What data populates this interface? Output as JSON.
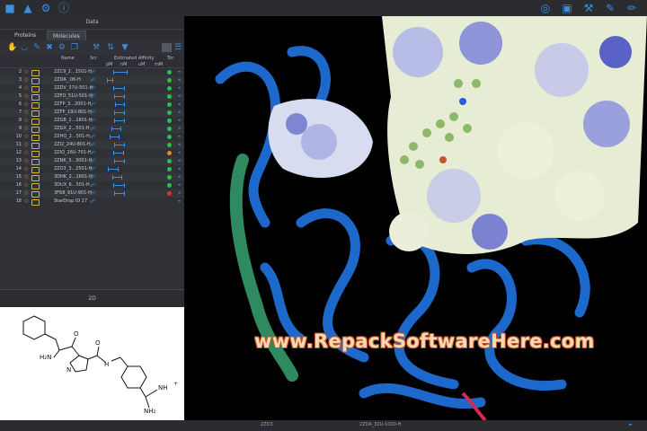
{
  "panel_title": "Data",
  "tabs": [
    "Proteins",
    "Molecules"
  ],
  "table": {
    "headers": {
      "name": "Name",
      "src": "Src",
      "affinity": "Estimated Affinity",
      "tor": "Tor"
    },
    "units": [
      "pM",
      "nM",
      "uM",
      "mM"
    ],
    "rows": [
      {
        "num": "2",
        "name": "2ZC9_2...1501-H",
        "status": "green",
        "bar": [
          0.12,
          0.35
        ]
      },
      {
        "num": "3",
        "name": "2ZDA_.06-H",
        "status": "green",
        "bar": [
          0.02,
          0.12
        ]
      },
      {
        "num": "4",
        "name": "2ZDV_37U-501-H",
        "status": "green",
        "bar": [
          0.12,
          0.3
        ]
      },
      {
        "num": "5",
        "name": "2ZFO_51U-501-H",
        "status": "green",
        "bar": [
          0.13,
          0.3
        ]
      },
      {
        "num": "6",
        "name": "2ZFP_3...2001-H",
        "status": "green",
        "bar": [
          0.14,
          0.3
        ]
      },
      {
        "num": "7",
        "name": "2ZFP_19U-801-H",
        "status": "green",
        "bar": [
          0.13,
          0.3
        ]
      },
      {
        "num": "8",
        "name": "2ZGB_2...1801-H",
        "status": "green",
        "bar": [
          0.13,
          0.3
        ]
      },
      {
        "num": "9",
        "name": "2ZGX_2...501-H",
        "status": "green",
        "bar": [
          0.08,
          0.25
        ]
      },
      {
        "num": "10",
        "name": "2ZHQ_2...501-H",
        "status": "green",
        "bar": [
          0.05,
          0.22
        ]
      },
      {
        "num": "11",
        "name": "2ZI2_24U-801-H",
        "status": "green",
        "bar": [
          0.13,
          0.3
        ]
      },
      {
        "num": "12",
        "name": "2ZIQ_26U-701-H",
        "status": "orange",
        "bar": [
          0.12,
          0.28
        ]
      },
      {
        "num": "13",
        "name": "2ZNK_3...3001-H",
        "status": "green",
        "bar": [
          0.13,
          0.3
        ]
      },
      {
        "num": "14",
        "name": "2ZO3_3...2501-H",
        "status": "green",
        "bar": [
          0.03,
          0.2
        ]
      },
      {
        "num": "15",
        "name": "3DHK_2...1601-H",
        "status": "green",
        "bar": [
          0.1,
          0.26
        ]
      },
      {
        "num": "16",
        "name": "3DUX_6...501-H",
        "status": "green",
        "bar": [
          0.12,
          0.3
        ]
      },
      {
        "num": "17",
        "name": "3F68_91U-901-H",
        "status": "red",
        "bar": [
          0.13,
          0.3
        ]
      },
      {
        "num": "18",
        "name": "StarDrop ID 17",
        "status": "",
        "bar": null
      }
    ]
  },
  "section_2d": "2D",
  "molecule_labels": {
    "h2n": "H₂N",
    "o1": "O",
    "o2": "O",
    "n": "N",
    "hn": "H",
    "nh": "NH",
    "nh2": "NH₂",
    "plus": "+"
  },
  "status_bar": {
    "left": "2ZD3",
    "center": "2ZDA_32U-1000-H"
  },
  "watermark": "www.RepackSoftwareHere.com",
  "colors": {
    "accent": "#3a8fe0",
    "ribbon": "#1f6fd6",
    "helix": "#2f8a5f"
  }
}
